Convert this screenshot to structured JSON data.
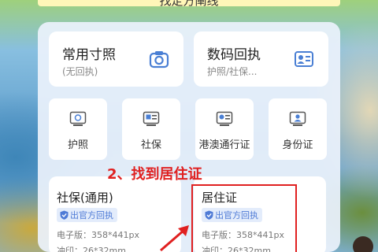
{
  "top_banner": {
    "text": "找定方阐线"
  },
  "big_cards": [
    {
      "title": "常用寸照",
      "sub": "(无回执)",
      "icon": "camera-icon"
    },
    {
      "title": "数码回执",
      "sub": "护照/社保...",
      "icon": "id-card-icon"
    }
  ],
  "small_cards": [
    {
      "label": "护照",
      "icon": "passport-icon"
    },
    {
      "label": "社保",
      "icon": "social-card-icon"
    },
    {
      "label": "港澳通行证",
      "icon": "travel-permit-icon"
    },
    {
      "label": "身份证",
      "icon": "id-card-icon"
    }
  ],
  "doc_cards": [
    {
      "title": "社保(通用)",
      "badge": "出官方回执",
      "line1": "电子版：358*441px",
      "line2": "冲印：26*32mm"
    },
    {
      "title": "居住证",
      "badge": "出官方回执",
      "line1": "电子版：358*441px",
      "line2": "冲印：26*32mm"
    }
  ],
  "annotation": {
    "text": "2、找到居住证"
  },
  "colors": {
    "accent_red": "#e02020",
    "badge_blue": "#4f7bd6",
    "icon_blue": "#4a7fd4"
  }
}
